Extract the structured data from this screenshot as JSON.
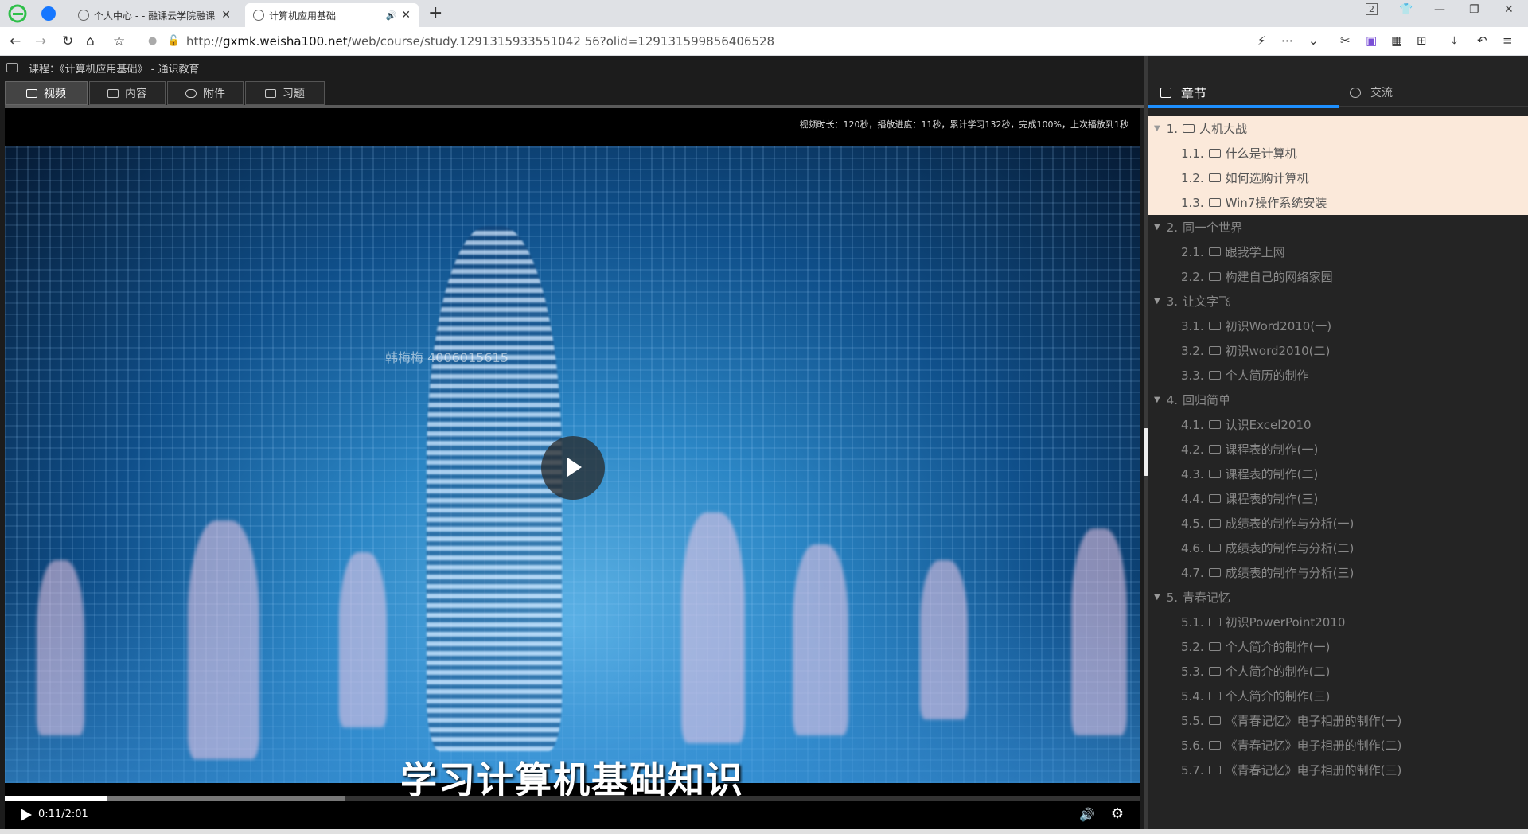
{
  "browser": {
    "tabs": [
      {
        "title": "个人中心 - - 融课云学院融课",
        "active": false
      },
      {
        "title": "计算机应用基础",
        "active": true,
        "audio": "🔊"
      }
    ],
    "new_tab": "+",
    "address": {
      "prefix": "http://",
      "host": "gxmk.weisha100.net",
      "path": "/web/course/study.1291315933551042 56?olid=129131599856406528"
    },
    "badge_count": "2"
  },
  "course": {
    "header": "课程：《计算机应用基础》 - 通识教育",
    "tabs": [
      {
        "label": "视频",
        "active": true
      },
      {
        "label": "内容",
        "active": false
      },
      {
        "label": "附件",
        "active": false
      },
      {
        "label": "习题",
        "active": false
      }
    ]
  },
  "video": {
    "stats": "视频时长：120秒，播放进度：11秒，累计学习132秒，完成100%，上次播放到1秒",
    "watermark": "韩梅梅 4006015615",
    "subtitle": "学习计算机基础知识",
    "time": "0:11/2:01",
    "progress_played": 0.09,
    "progress_buffered": 0.3
  },
  "sidebar": {
    "tab_chapters": "章节",
    "tab_chat": "交流",
    "chapters": [
      {
        "num": "1.",
        "title": "人机大战",
        "highlight": true,
        "lessons": [
          {
            "num": "1.1.",
            "title": "什么是计算机"
          },
          {
            "num": "1.2.",
            "title": "如何选购计算机"
          },
          {
            "num": "1.3.",
            "title": "Win7操作系统安装"
          }
        ]
      },
      {
        "num": "2.",
        "title": "同一个世界",
        "highlight": false,
        "lessons": [
          {
            "num": "2.1.",
            "title": "跟我学上网"
          },
          {
            "num": "2.2.",
            "title": "构建自己的网络家园"
          }
        ]
      },
      {
        "num": "3.",
        "title": "让文字飞",
        "highlight": false,
        "lessons": [
          {
            "num": "3.1.",
            "title": "初识Word2010(一)"
          },
          {
            "num": "3.2.",
            "title": "初识word2010(二)"
          },
          {
            "num": "3.3.",
            "title": "个人简历的制作"
          }
        ]
      },
      {
        "num": "4.",
        "title": "回归简单",
        "highlight": false,
        "lessons": [
          {
            "num": "4.1.",
            "title": "认识Excel2010"
          },
          {
            "num": "4.2.",
            "title": "课程表的制作(一)"
          },
          {
            "num": "4.3.",
            "title": "课程表的制作(二)"
          },
          {
            "num": "4.4.",
            "title": "课程表的制作(三)"
          },
          {
            "num": "4.5.",
            "title": "成绩表的制作与分析(一)"
          },
          {
            "num": "4.6.",
            "title": "成绩表的制作与分析(二)"
          },
          {
            "num": "4.7.",
            "title": "成绩表的制作与分析(三)"
          }
        ]
      },
      {
        "num": "5.",
        "title": "青春记忆",
        "highlight": false,
        "lessons": [
          {
            "num": "5.1.",
            "title": "初识PowerPoint2010"
          },
          {
            "num": "5.2.",
            "title": "个人简介的制作(一)"
          },
          {
            "num": "5.3.",
            "title": "个人简介的制作(二)"
          },
          {
            "num": "5.4.",
            "title": "个人简介的制作(三)"
          },
          {
            "num": "5.5.",
            "title": "《青春记忆》电子相册的制作(一)"
          },
          {
            "num": "5.6.",
            "title": "《青春记忆》电子相册的制作(二)"
          },
          {
            "num": "5.7.",
            "title": "《青春记忆》电子相册的制作(三)"
          }
        ]
      }
    ]
  }
}
